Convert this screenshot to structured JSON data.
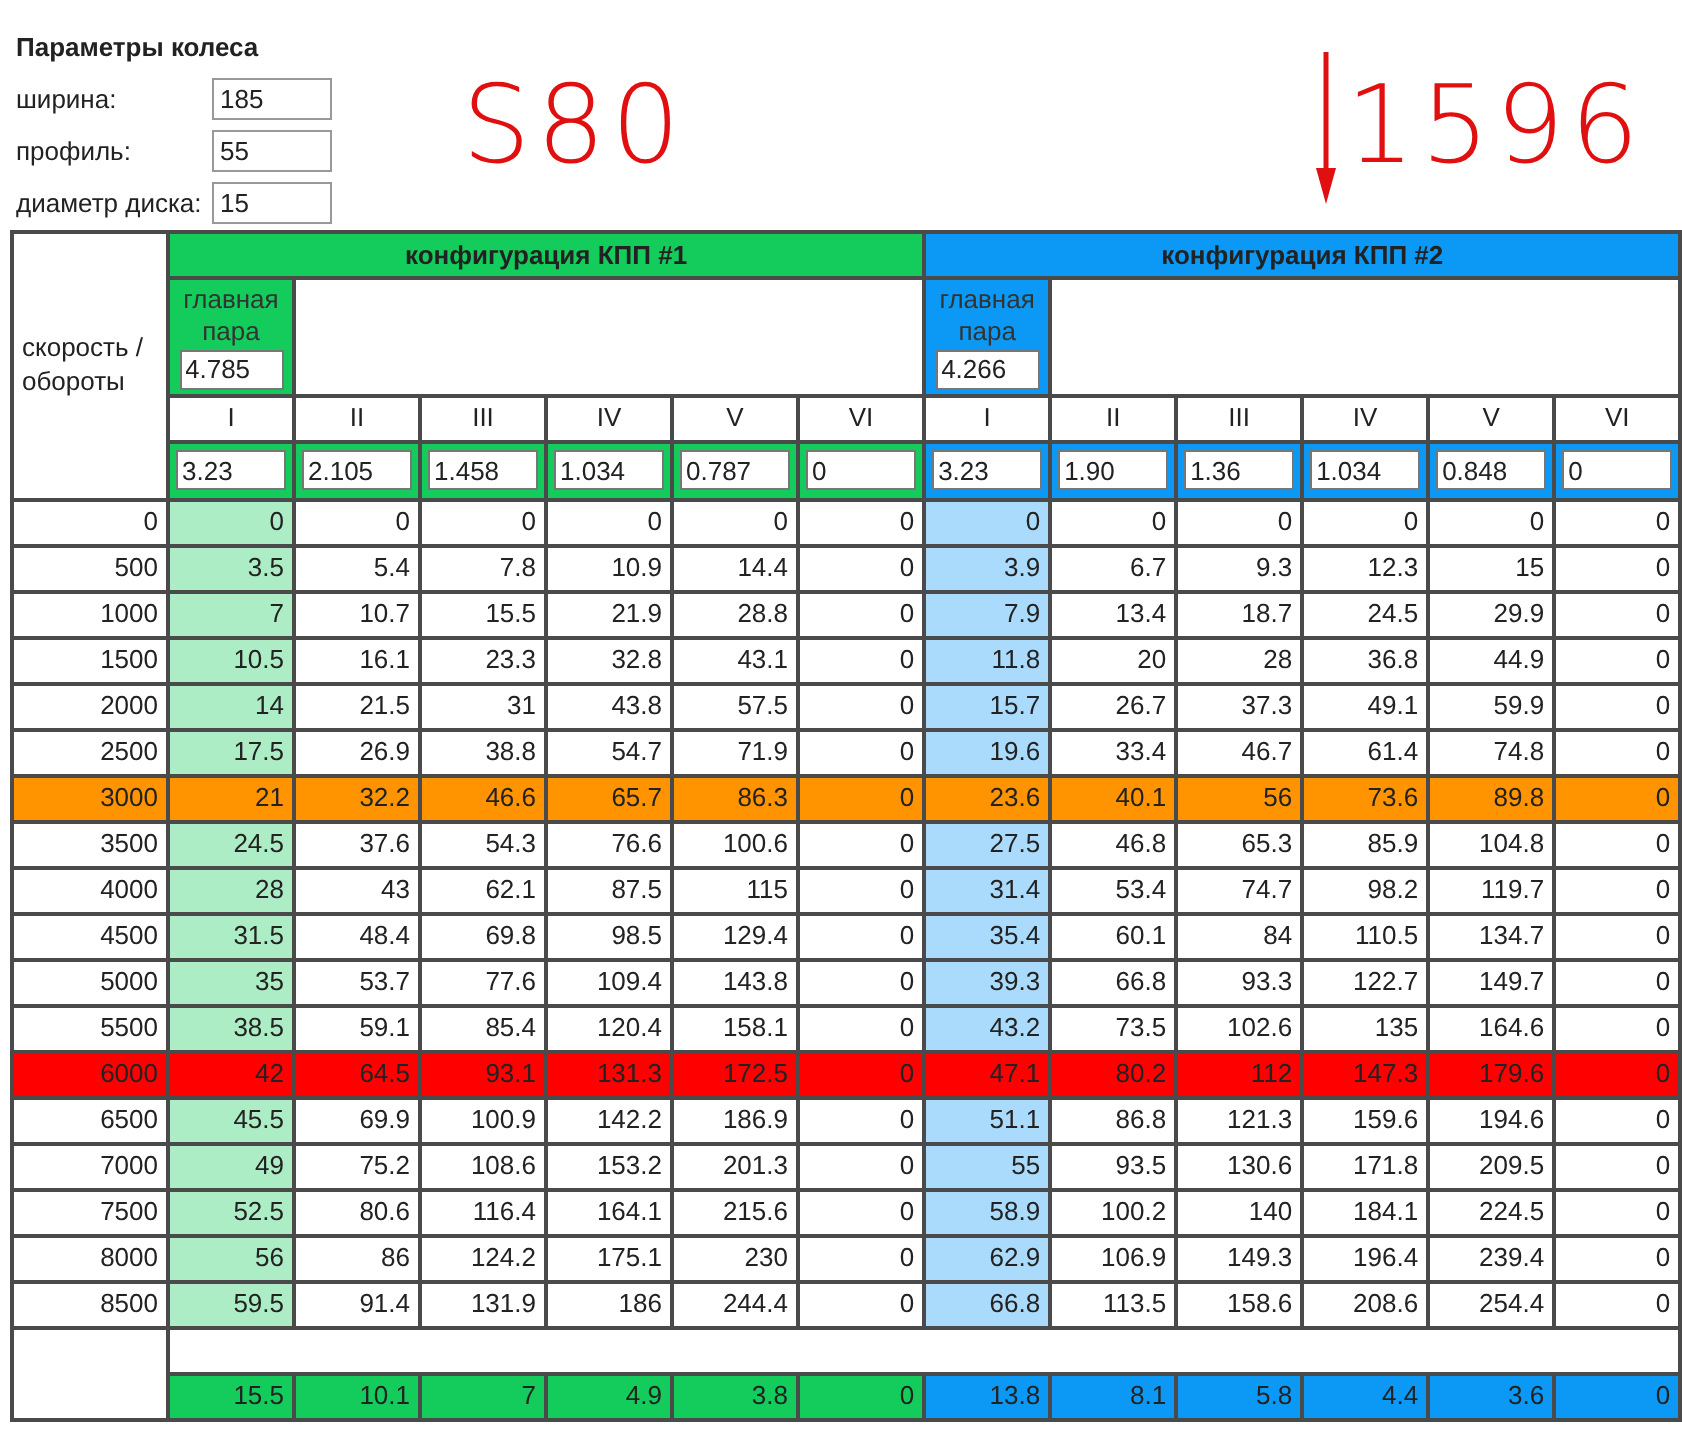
{
  "wheel": {
    "title": "Параметры колеса",
    "fields": [
      {
        "label": "ширина:",
        "value": "185"
      },
      {
        "label": "профиль:",
        "value": "55"
      },
      {
        "label": "диаметр диска:",
        "value": "15"
      }
    ]
  },
  "notes": [
    {
      "kind": "text",
      "text": "S80"
    },
    {
      "kind": "arrow"
    },
    {
      "kind": "text",
      "text": "1596"
    }
  ],
  "table": {
    "corner_label": "скорость / обороты",
    "configs": [
      {
        "title": "конфигурация КПП #1",
        "color": "#14cc5c",
        "main_pair_label": "главная пара",
        "main_pair": "4.785",
        "gears": [
          "I",
          "II",
          "III",
          "IV",
          "V",
          "VI"
        ],
        "ratios": [
          "3.23",
          "2.105",
          "1.458",
          "1.034",
          "0.787",
          "0"
        ],
        "totals": [
          "15.5",
          "10.1",
          "7",
          "4.9",
          "3.8",
          "0"
        ]
      },
      {
        "title": "конфигурация КПП #2",
        "color": "#0b99f5",
        "main_pair_label": "главная пара",
        "main_pair": "4.266",
        "gears": [
          "I",
          "II",
          "III",
          "IV",
          "V",
          "VI"
        ],
        "ratios": [
          "3.23",
          "1.90",
          "1.36",
          "1.034",
          "0.848",
          "0"
        ],
        "totals": [
          "13.8",
          "8.1",
          "5.8",
          "4.4",
          "3.6",
          "0"
        ]
      }
    ],
    "rows": [
      {
        "rpm": "0",
        "speeds": [
          [
            "0",
            "0",
            "0",
            "0",
            "0",
            "0"
          ],
          [
            "0",
            "0",
            "0",
            "0",
            "0",
            "0"
          ]
        ]
      },
      {
        "rpm": "500",
        "speeds": [
          [
            "3.5",
            "5.4",
            "7.8",
            "10.9",
            "14.4",
            "0"
          ],
          [
            "3.9",
            "6.7",
            "9.3",
            "12.3",
            "15",
            "0"
          ]
        ]
      },
      {
        "rpm": "1000",
        "speeds": [
          [
            "7",
            "10.7",
            "15.5",
            "21.9",
            "28.8",
            "0"
          ],
          [
            "7.9",
            "13.4",
            "18.7",
            "24.5",
            "29.9",
            "0"
          ]
        ]
      },
      {
        "rpm": "1500",
        "speeds": [
          [
            "10.5",
            "16.1",
            "23.3",
            "32.8",
            "43.1",
            "0"
          ],
          [
            "11.8",
            "20",
            "28",
            "36.8",
            "44.9",
            "0"
          ]
        ]
      },
      {
        "rpm": "2000",
        "speeds": [
          [
            "14",
            "21.5",
            "31",
            "43.8",
            "57.5",
            "0"
          ],
          [
            "15.7",
            "26.7",
            "37.3",
            "49.1",
            "59.9",
            "0"
          ]
        ]
      },
      {
        "rpm": "2500",
        "speeds": [
          [
            "17.5",
            "26.9",
            "38.8",
            "54.7",
            "71.9",
            "0"
          ],
          [
            "19.6",
            "33.4",
            "46.7",
            "61.4",
            "74.8",
            "0"
          ]
        ]
      },
      {
        "rpm": "3000",
        "color": "#ff9300",
        "speeds": [
          [
            "21",
            "32.2",
            "46.6",
            "65.7",
            "86.3",
            "0"
          ],
          [
            "23.6",
            "40.1",
            "56",
            "73.6",
            "89.8",
            "0"
          ]
        ]
      },
      {
        "rpm": "3500",
        "speeds": [
          [
            "24.5",
            "37.6",
            "54.3",
            "76.6",
            "100.6",
            "0"
          ],
          [
            "27.5",
            "46.8",
            "65.3",
            "85.9",
            "104.8",
            "0"
          ]
        ]
      },
      {
        "rpm": "4000",
        "speeds": [
          [
            "28",
            "43",
            "62.1",
            "87.5",
            "115",
            "0"
          ],
          [
            "31.4",
            "53.4",
            "74.7",
            "98.2",
            "119.7",
            "0"
          ]
        ]
      },
      {
        "rpm": "4500",
        "speeds": [
          [
            "31.5",
            "48.4",
            "69.8",
            "98.5",
            "129.4",
            "0"
          ],
          [
            "35.4",
            "60.1",
            "84",
            "110.5",
            "134.7",
            "0"
          ]
        ]
      },
      {
        "rpm": "5000",
        "speeds": [
          [
            "35",
            "53.7",
            "77.6",
            "109.4",
            "143.8",
            "0"
          ],
          [
            "39.3",
            "66.8",
            "93.3",
            "122.7",
            "149.7",
            "0"
          ]
        ]
      },
      {
        "rpm": "5500",
        "speeds": [
          [
            "38.5",
            "59.1",
            "85.4",
            "120.4",
            "158.1",
            "0"
          ],
          [
            "43.2",
            "73.5",
            "102.6",
            "135",
            "164.6",
            "0"
          ]
        ]
      },
      {
        "rpm": "6000",
        "color": "#ff0000",
        "speeds": [
          [
            "42",
            "64.5",
            "93.1",
            "131.3",
            "172.5",
            "0"
          ],
          [
            "47.1",
            "80.2",
            "112",
            "147.3",
            "179.6",
            "0"
          ]
        ]
      },
      {
        "rpm": "6500",
        "speeds": [
          [
            "45.5",
            "69.9",
            "100.9",
            "142.2",
            "186.9",
            "0"
          ],
          [
            "51.1",
            "86.8",
            "121.3",
            "159.6",
            "194.6",
            "0"
          ]
        ]
      },
      {
        "rpm": "7000",
        "speeds": [
          [
            "49",
            "75.2",
            "108.6",
            "153.2",
            "201.3",
            "0"
          ],
          [
            "55",
            "93.5",
            "130.6",
            "171.8",
            "209.5",
            "0"
          ]
        ]
      },
      {
        "rpm": "7500",
        "speeds": [
          [
            "52.5",
            "80.6",
            "116.4",
            "164.1",
            "215.6",
            "0"
          ],
          [
            "58.9",
            "100.2",
            "140",
            "184.1",
            "224.5",
            "0"
          ]
        ]
      },
      {
        "rpm": "8000",
        "speeds": [
          [
            "56",
            "86",
            "124.2",
            "175.1",
            "230",
            "0"
          ],
          [
            "62.9",
            "106.9",
            "149.3",
            "196.4",
            "239.4",
            "0"
          ]
        ]
      },
      {
        "rpm": "8500",
        "speeds": [
          [
            "59.5",
            "91.4",
            "131.9",
            "186",
            "244.4",
            "0"
          ],
          [
            "66.8",
            "113.5",
            "158.6",
            "208.6",
            "254.4",
            "0"
          ]
        ]
      }
    ]
  }
}
